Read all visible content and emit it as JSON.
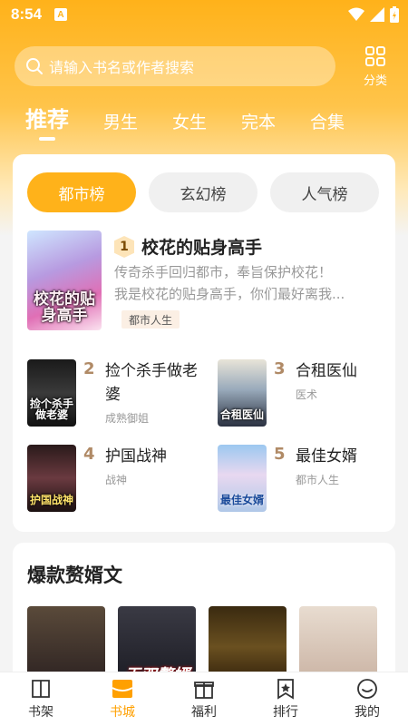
{
  "status_bar": {
    "time": "8:54",
    "badge": "A"
  },
  "search": {
    "placeholder": "请输入书名或作者搜索"
  },
  "category": {
    "label": "分类"
  },
  "tabs": [
    {
      "label": "推荐",
      "active": true
    },
    {
      "label": "男生"
    },
    {
      "label": "女生"
    },
    {
      "label": "完本"
    },
    {
      "label": "合集"
    }
  ],
  "rank_tabs": [
    {
      "label": "都市榜",
      "active": true
    },
    {
      "label": "玄幻榜"
    },
    {
      "label": "人气榜"
    }
  ],
  "top_book": {
    "rank": "1",
    "title": "校花的贴身高手",
    "desc_line1": "传奇杀手回归都市，奉旨保护校花！",
    "desc_line2": "我是校花的贴身高手，你们最好离我...",
    "tag": "都市人生",
    "cover_text": "校花的贴身高手"
  },
  "books": [
    {
      "rank": "2",
      "title": "捡个杀手做老婆",
      "tag": "成熟御姐",
      "cover_text": "捡个杀手做老婆"
    },
    {
      "rank": "3",
      "title": "合租医仙",
      "tag": "医术",
      "cover_text": "合租医仙"
    },
    {
      "rank": "4",
      "title": "护国战神",
      "tag": "战神",
      "cover_text": "护国战神"
    },
    {
      "rank": "5",
      "title": "最佳女婿",
      "tag": "都市人生",
      "cover_text": "最佳女婿"
    }
  ],
  "section2": {
    "title": "爆款赘婿文",
    "second_cover_text": "无双赘婿"
  },
  "bottom_nav": [
    {
      "label": "书架",
      "icon": "book-icon"
    },
    {
      "label": "书城",
      "icon": "store-icon",
      "active": true
    },
    {
      "label": "福利",
      "icon": "gift-icon"
    },
    {
      "label": "排行",
      "icon": "ranking-bookmark-icon"
    },
    {
      "label": "我的",
      "icon": "face-icon"
    }
  ],
  "colors": {
    "accent": "#ffb21a",
    "active_nav": "#ffa000",
    "rank_num": "#b08a66"
  }
}
